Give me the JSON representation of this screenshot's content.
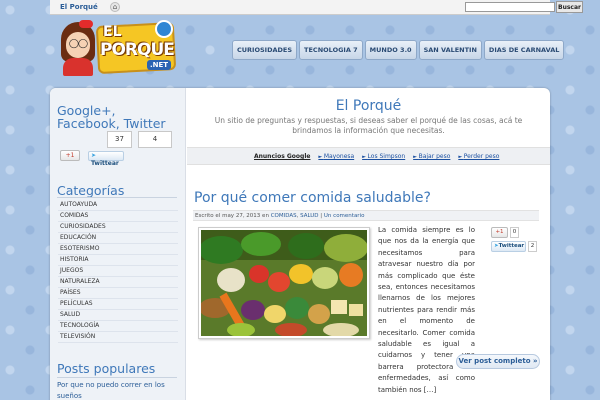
{
  "topbar": {
    "brand_el": "El",
    "brand_name": "Porqué",
    "search_placeholder": "",
    "search_button": "Buscar"
  },
  "logo": {
    "el": "EL",
    "name": "PORQUE",
    "tld": ".NET"
  },
  "nav": {
    "items": [
      {
        "label": "CURIOSIDADES"
      },
      {
        "label": "TECNOLOGIA 7"
      },
      {
        "label": "MUNDO 3.0"
      },
      {
        "label": "SAN VALENTIN"
      },
      {
        "label": "DIAS DE CARNAVAL"
      }
    ]
  },
  "sidebar": {
    "social_heading": "Google+, Facebook, Twitter",
    "counts": [
      "37",
      "4"
    ],
    "gplus_label": "+1",
    "tweet_label": "Twittear",
    "categories_heading": "Categorías",
    "categories": [
      "AUTOAYUDA",
      "COMIDAS",
      "CURIOSIDADES",
      "EDUCACIÓN",
      "ESOTERISMO",
      "HISTORIA",
      "JUEGOS",
      "NATURALEZA",
      "PAÍSES",
      "PELÍCULAS",
      "SALUD",
      "TECNOLOGÍA",
      "TELEVISIÓN"
    ],
    "popular_heading": "Posts populares",
    "popular_first": "Por que no puedo correr en los sueños"
  },
  "header": {
    "title": "El Porqué",
    "description": "Un sitio de preguntas y respuestas, si deseas saber el porqué de las cosas, acá te brindamos la información que necesitas."
  },
  "ads": {
    "label": "Anuncios Google",
    "links": [
      "Mayonesa",
      "Los Simpson",
      "Bajar peso",
      "Perder peso"
    ]
  },
  "post": {
    "title": "Por qué comer comida saludable?",
    "meta_prefix": "Escrito el may 27, 2013 en",
    "category_1": "COMIDAS",
    "category_2": "SALUD",
    "comments": "Un comentario",
    "body": "La comida siempre es lo que nos da la energía que necesitamos para atravesar nuestro día por más complicado que éste sea, entonces necesitamos llenarnos de los mejores nutrientes para rendir más en el momento de necesitarlo. Comer comida saludable es igual a cuidarnos y tener una barrera protectora de enfermedades, así como también nos […]",
    "gplus_label": "+1",
    "gplus_count": "0",
    "tweet_label": "Twittear",
    "tweet_count": "2",
    "read_more": "Ver post completo »"
  }
}
